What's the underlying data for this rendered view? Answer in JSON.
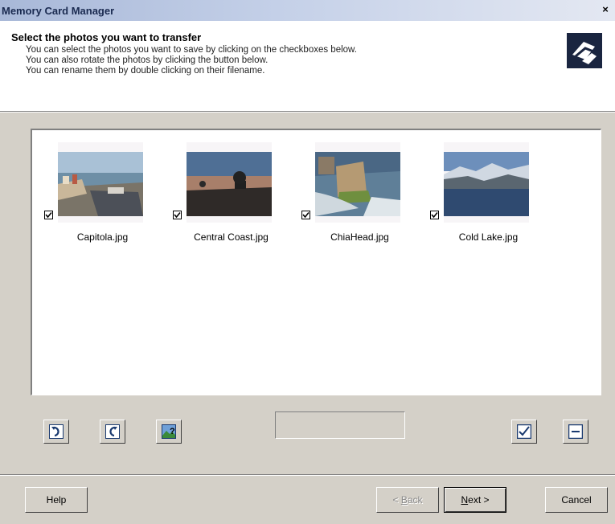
{
  "window": {
    "title": "Memory Card Manager",
    "close_label": "×"
  },
  "header": {
    "title": "Select the photos you want to transfer",
    "lines": [
      "You can select the photos you want to save by clicking on the checkboxes below.",
      "You can also rotate the photos by clicking the button below.",
      "You can rename them by double clicking on their filename."
    ],
    "icon": "camera-transfer-icon"
  },
  "photos": [
    {
      "filename": "Capitola.jpg",
      "checked": true
    },
    {
      "filename": "Central Coast.jpg",
      "checked": true
    },
    {
      "filename": "ChiaHead.jpg",
      "checked": true
    },
    {
      "filename": "Cold Lake.jpg",
      "checked": true
    }
  ],
  "toolbar": {
    "rotate_left_icon": "rotate-left-icon",
    "rotate_right_icon": "rotate-right-icon",
    "photo_info_icon": "image-help-icon",
    "select_all_icon": "checkbox-checked-icon",
    "deselect_all_icon": "checkbox-minus-icon"
  },
  "buttons": {
    "help": "Help",
    "back_pre": "< ",
    "back_key": "B",
    "back_post": "ack",
    "next_key": "N",
    "next_post": "ext >",
    "cancel": "Cancel"
  }
}
